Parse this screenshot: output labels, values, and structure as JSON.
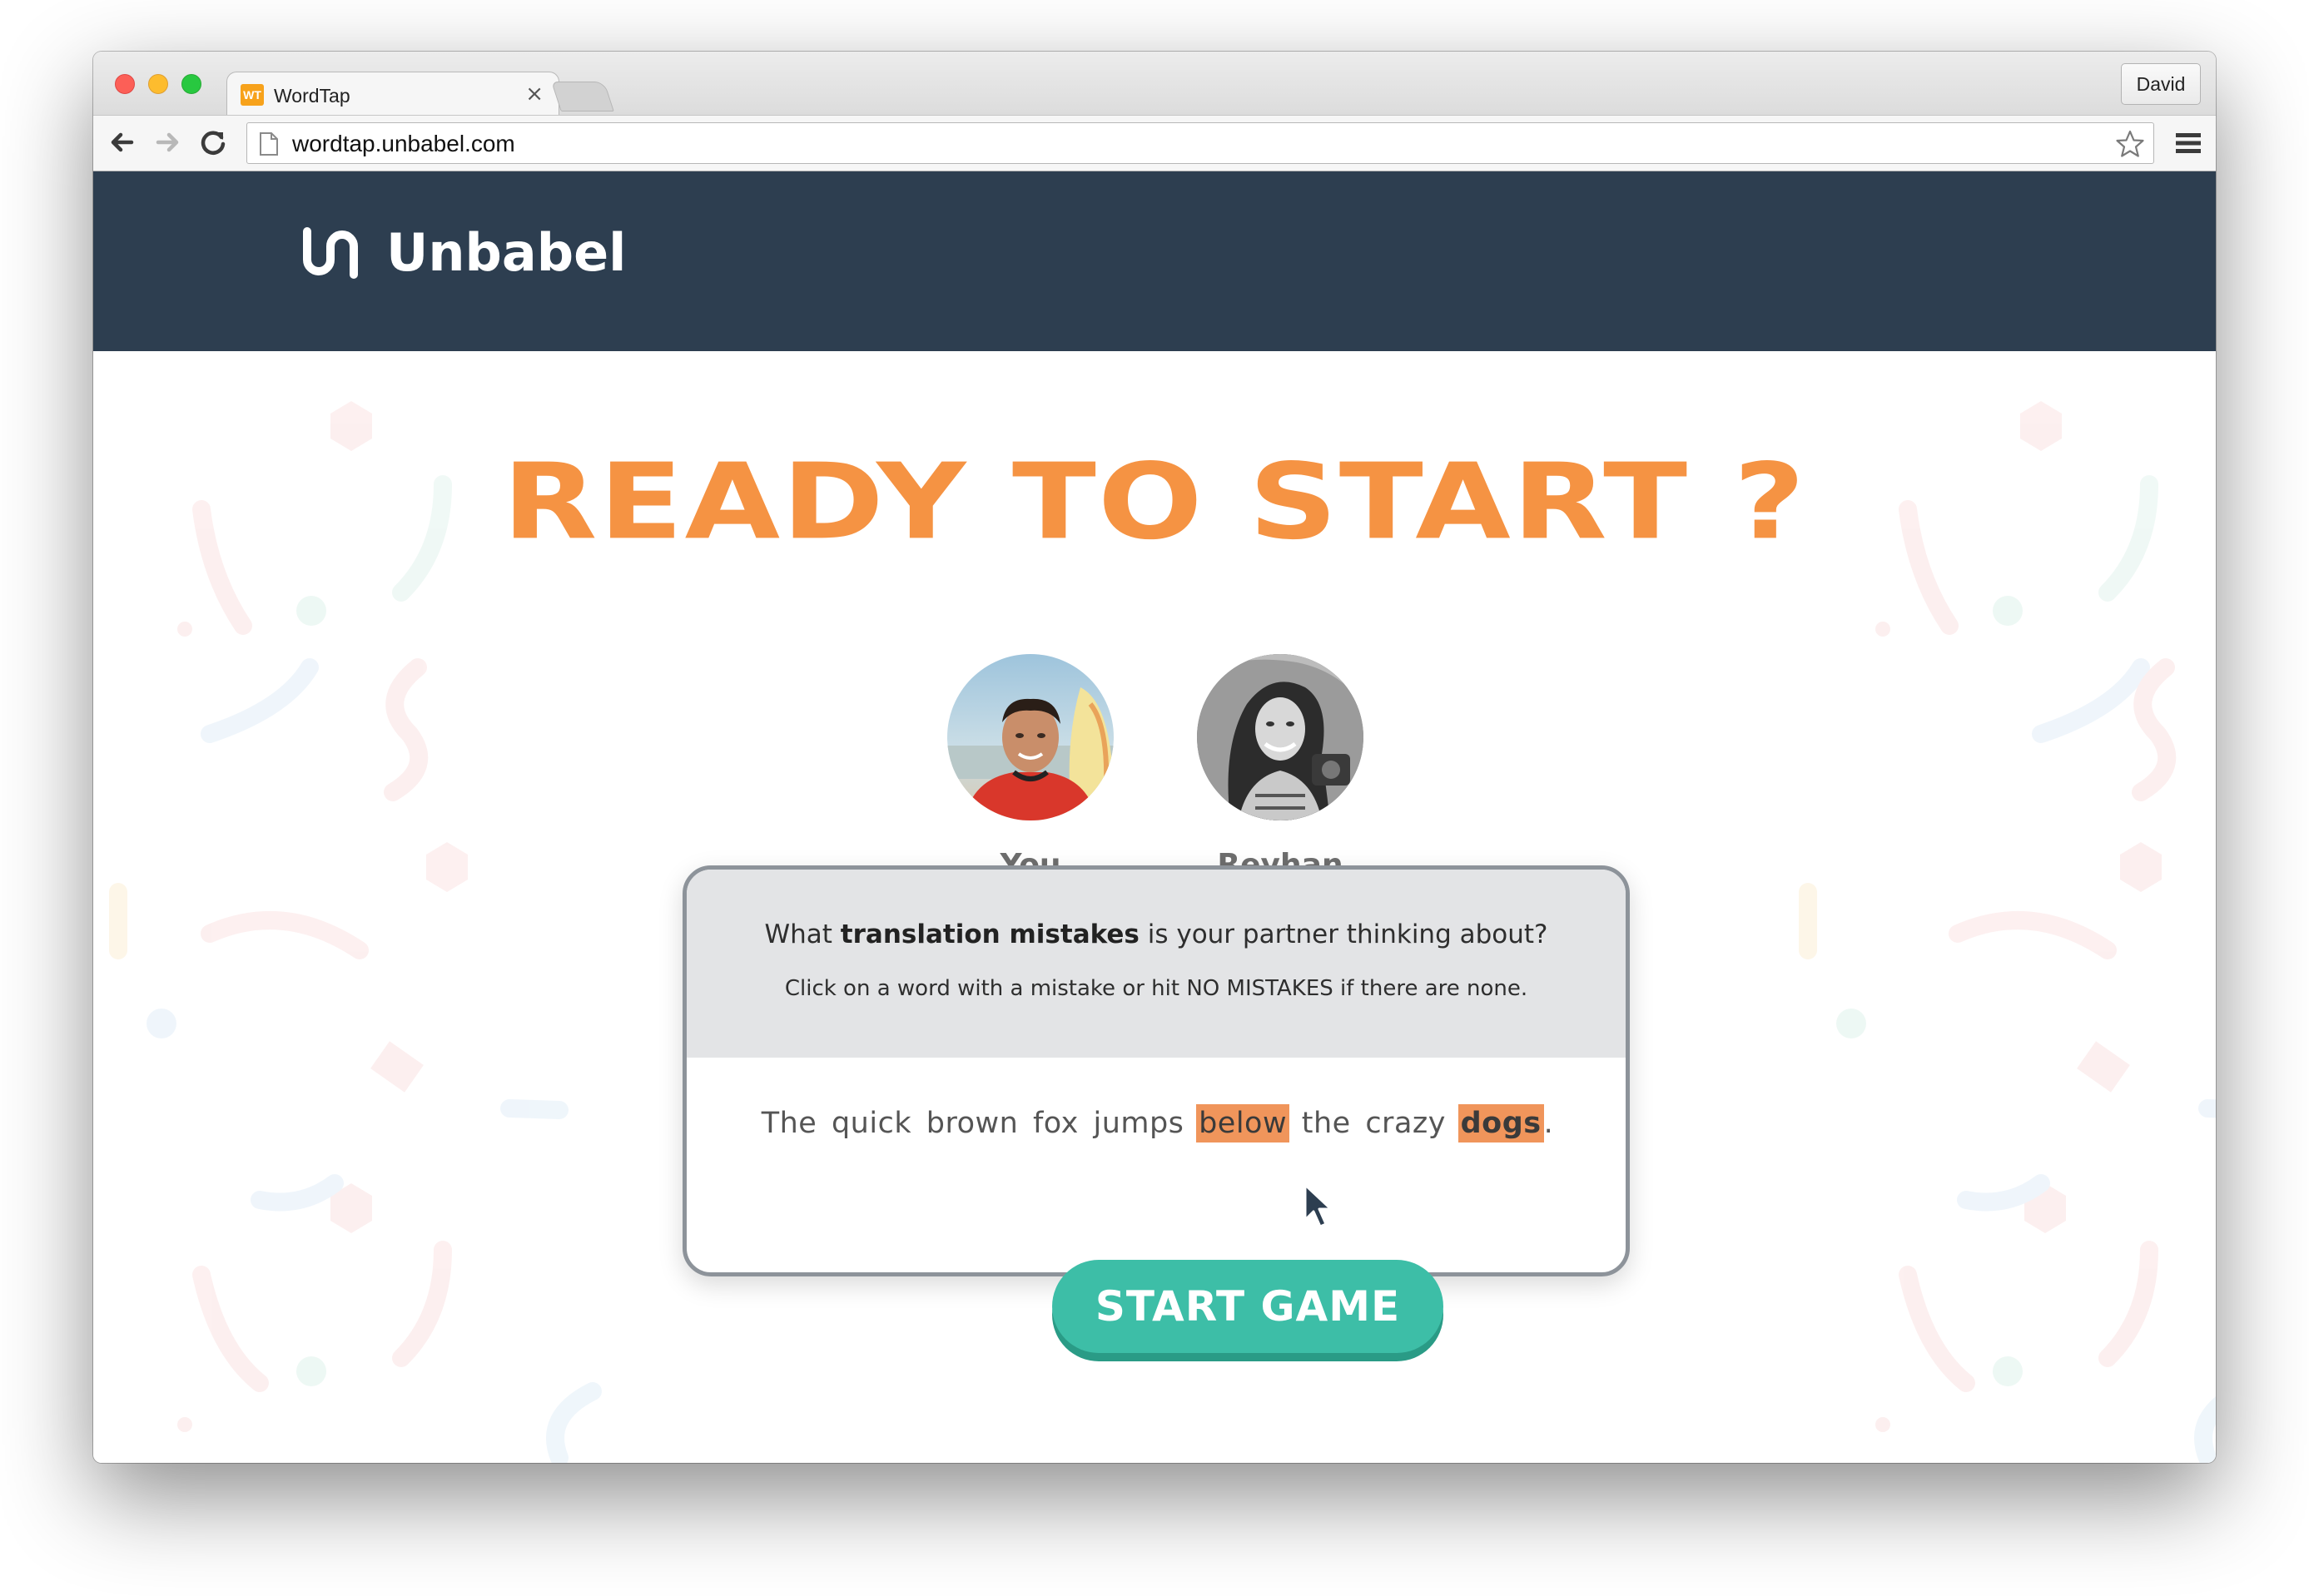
{
  "browser": {
    "tab_favicon_text": "WT",
    "tab_title": "WordTap",
    "tab_close": "×",
    "profile_name": "David",
    "url": "wordtap.unbabel.com"
  },
  "header": {
    "brand": "Unbabel"
  },
  "hero": {
    "title": "READY TO START ?"
  },
  "players": [
    {
      "name": "You"
    },
    {
      "name": "Reyhan"
    }
  ],
  "card": {
    "question_pre": "What ",
    "question_bold": "translation mistakes",
    "question_post": " is your partner thinking about?",
    "instruction": "Click on a word with a mistake or hit NO MISTAKES if there are none.",
    "sentence": [
      {
        "text": "The",
        "marked": false,
        "bold": false
      },
      {
        "text": "quick",
        "marked": false,
        "bold": false
      },
      {
        "text": "brown",
        "marked": false,
        "bold": false
      },
      {
        "text": "fox",
        "marked": false,
        "bold": false
      },
      {
        "text": "jumps",
        "marked": false,
        "bold": false
      },
      {
        "text": "below",
        "marked": true,
        "bold": false
      },
      {
        "text": "the",
        "marked": false,
        "bold": false
      },
      {
        "text": "crazy",
        "marked": false,
        "bold": false
      },
      {
        "text": "dogs",
        "marked": true,
        "bold": true
      }
    ],
    "sentence_end": "."
  },
  "start_button": {
    "label": "START GAME"
  },
  "colors": {
    "header_bg": "#2d3e50",
    "accent_orange": "#f59343",
    "mistake_highlight": "#f0955b",
    "button_teal": "#3dbea7",
    "card_border": "#8d939a"
  },
  "icons": [
    "back-arrow-icon",
    "forward-arrow-icon",
    "reload-icon",
    "page-icon",
    "star-icon",
    "menu-icon",
    "unbabel-logo-icon",
    "mouse-cursor-icon"
  ]
}
